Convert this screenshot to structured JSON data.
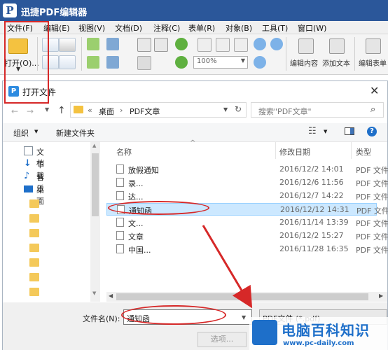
{
  "app": {
    "title": "迅捷PDF编辑器",
    "logo_letter": "P"
  },
  "menu": [
    "文件(F)",
    "编辑(E)",
    "视图(V)",
    "文档(D)",
    "注释(C)",
    "表单(R)",
    "对象(B)",
    "工具(T)",
    "窗口(W)"
  ],
  "toolbar": {
    "open_label": "打开(O)...",
    "zoom_value": "100%",
    "edit_content": "编辑内容",
    "add_text": "添加文本",
    "edit_form": "编辑表单"
  },
  "dialog": {
    "title": "打开文件",
    "close": "✕",
    "address": {
      "seg1": "桌面",
      "seg2": "PDF文章",
      "sep": "›",
      "prefix": "«"
    },
    "search_placeholder": "搜索\"PDF文章\"",
    "organize": "组织",
    "new_folder": "新建文件夹",
    "nav_items": [
      {
        "label": "文档",
        "icon": "document-icon"
      },
      {
        "label": "下载",
        "icon": "download-icon"
      },
      {
        "label": "音乐",
        "icon": "music-icon"
      },
      {
        "label": "桌面",
        "icon": "desktop-icon"
      }
    ],
    "columns": {
      "name": "名称",
      "date": "修改日期",
      "type": "类型"
    },
    "files": [
      {
        "name": "放假通知",
        "date": "2016/12/2 14:01",
        "type": "PDF 文件"
      },
      {
        "name": "录...",
        "date": "2016/12/6 11:56",
        "type": "PDF 文件"
      },
      {
        "name": "达...",
        "date": "2016/12/7 14:22",
        "type": "PDF 文件"
      },
      {
        "name": "通知函",
        "date": "2016/12/12 14:31",
        "type": "PDF 文件"
      },
      {
        "name": "文...",
        "date": "2016/11/14 13:39",
        "type": "PDF 文件"
      },
      {
        "name": "文章",
        "date": "2016/12/2 15:27",
        "type": "PDF 文件"
      },
      {
        "name": "中国...",
        "date": "2016/11/28 16:35",
        "type": "PDF 文件"
      }
    ],
    "filename_label": "文件名(N):",
    "filename_value": "通知函",
    "filetype_value": "PDF文件 (*.pdf)",
    "options_button": "选项..."
  },
  "watermark": {
    "title": "电脑百科知识",
    "url": "www.pc-daily.com"
  },
  "colors": {
    "titlebar": "#2b579a",
    "annotation": "#d62828",
    "selection": "#cce8ff",
    "folder": "#f4c240",
    "brand": "#1e6fc9"
  }
}
